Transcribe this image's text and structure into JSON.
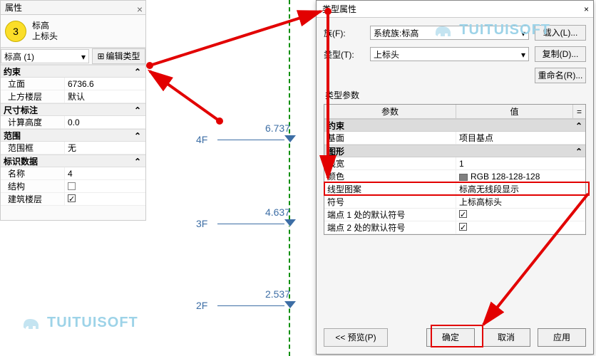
{
  "prop_panel": {
    "title": "属性",
    "badge": "3",
    "type_line1": "标高",
    "type_line2": "上标头",
    "selector": "标高 (1)",
    "edit_type": "编辑类型",
    "groups": {
      "constraint": {
        "header": "约束",
        "rows": [
          {
            "label": "立面",
            "value": "6736.6"
          },
          {
            "label": "上方楼层",
            "value": "默认"
          }
        ]
      },
      "dimensions": {
        "header": "尺寸标注",
        "rows": [
          {
            "label": "计算高度",
            "value": "0.0"
          }
        ]
      },
      "extent": {
        "header": "范围",
        "rows": [
          {
            "label": "范围框",
            "value": "无"
          }
        ]
      },
      "identity": {
        "header": "标识数据",
        "rows": [
          {
            "label": "名称",
            "value": "4"
          },
          {
            "label": "结构",
            "value": "☐"
          },
          {
            "label": "建筑楼层",
            "value": "☑"
          }
        ]
      }
    }
  },
  "levels": [
    {
      "name": "4F",
      "elev": "6.737"
    },
    {
      "name": "3F",
      "elev": "4.637"
    },
    {
      "name": "2F",
      "elev": "2.537"
    }
  ],
  "dialog": {
    "title": "类型属性",
    "family_label": "族(F):",
    "family_value": "系统族:标高",
    "load_btn": "载入(L)...",
    "type_label": "类型(T):",
    "type_value": "上标头",
    "copy_btn": "复制(D)...",
    "rename_btn": "重命名(R)...",
    "section": "类型参数",
    "header_param": "参数",
    "header_value": "值",
    "group_constraint": "约束",
    "row_base_label": "基面",
    "row_base_value": "项目基点",
    "group_graphic": "图形",
    "row_weight_label": "线宽",
    "row_weight_value": "1",
    "row_color_label": "颜色",
    "row_color_value": "RGB 128-128-128",
    "row_pattern_label": "线型图案",
    "row_pattern_value": "标高无线段显示",
    "row_symbol_label": "符号",
    "row_symbol_value": "上标高标头",
    "row_end1_label": "端点 1 处的默认符号",
    "row_end2_label": "端点 2 处的默认符号",
    "preview_btn": "<< 预览(P)",
    "ok_btn": "确定",
    "cancel_btn": "取消",
    "apply_btn": "应用"
  },
  "watermark": "TUITUISOFT"
}
